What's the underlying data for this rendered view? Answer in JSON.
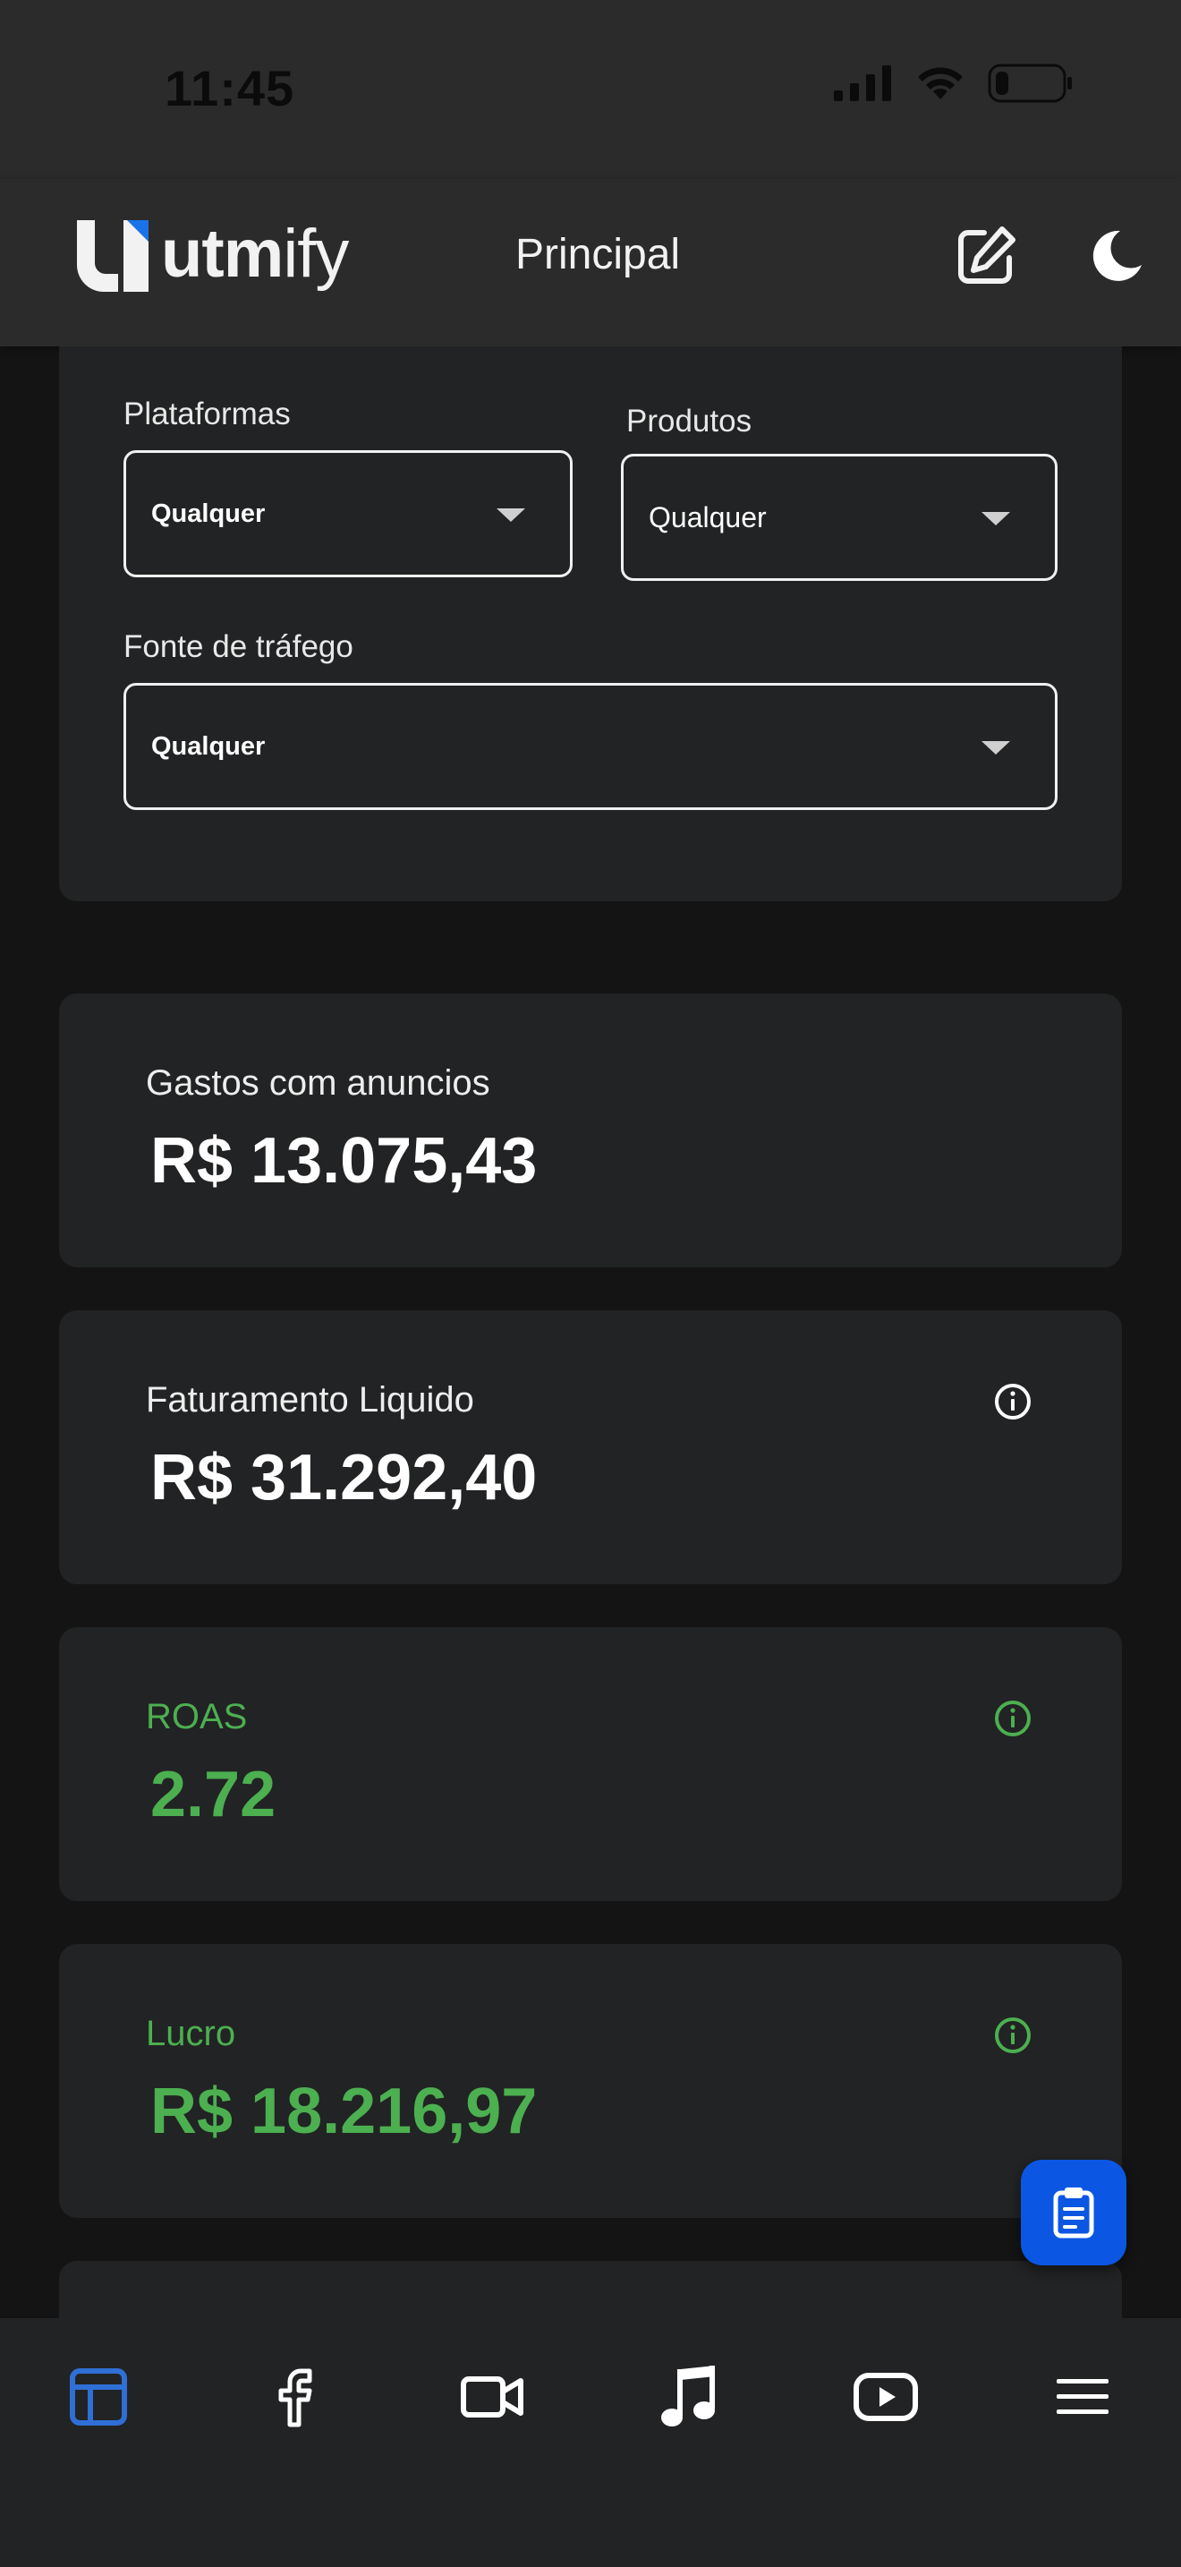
{
  "status_bar": {
    "time": "11:45",
    "battery_level": 0.2
  },
  "header": {
    "logo_text_bold": "utm",
    "logo_text_rest": "ify",
    "title": "Principal",
    "edit_icon": "edit-icon",
    "theme_icon": "moon-icon"
  },
  "filters": {
    "platforms": {
      "label": "Plataformas",
      "value": "Qualquer"
    },
    "products": {
      "label": "Produtos",
      "value": "Qualquer"
    },
    "traffic_source": {
      "label": "Fonte de tráfego",
      "value": "Qualquer"
    }
  },
  "metrics": [
    {
      "label": "Gastos com anuncios",
      "value": "R$ 13.075,43",
      "color": "#ffffff",
      "info": false
    },
    {
      "label": "Faturamento Liquido",
      "value": "R$ 31.292,40",
      "color": "#ffffff",
      "info": true
    },
    {
      "label": "ROAS",
      "value": "2.72",
      "color": "#4caf50",
      "info": true
    },
    {
      "label": "Lucro",
      "value": "R$ 18.216,97",
      "color": "#4caf50",
      "info": true
    }
  ],
  "fab": {
    "icon": "clipboard-icon",
    "color": "#0b57e3"
  },
  "bottom_nav": {
    "active": 0,
    "active_color": "#2f6fd6",
    "items": [
      "dashboard-icon",
      "facebook-icon",
      "video-icon",
      "music-icon",
      "youtube-icon",
      "menu-icon"
    ]
  }
}
